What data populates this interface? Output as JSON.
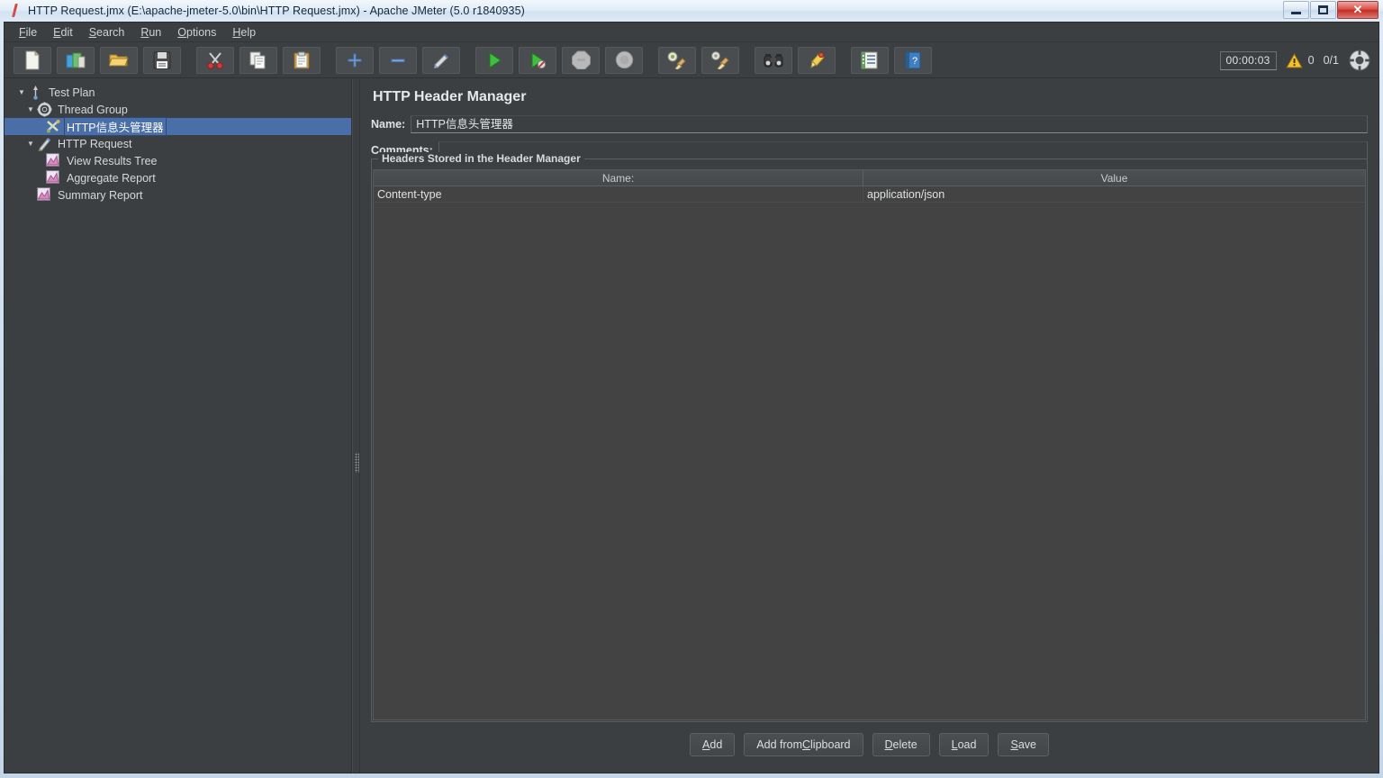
{
  "window": {
    "title": "HTTP Request.jmx (E:\\apache-jmeter-5.0\\bin\\HTTP Request.jmx) - Apache JMeter (5.0 r1840935)",
    "app_icon": "jmeter-feather-icon",
    "controls": {
      "minimize": "minimize-icon",
      "maximize": "maximize-icon",
      "close": "✕"
    }
  },
  "menubar": {
    "items": [
      {
        "label": "File",
        "mnemonic": "F"
      },
      {
        "label": "Edit",
        "mnemonic": "E"
      },
      {
        "label": "Search",
        "mnemonic": "S"
      },
      {
        "label": "Run",
        "mnemonic": "R"
      },
      {
        "label": "Options",
        "mnemonic": "O"
      },
      {
        "label": "Help",
        "mnemonic": "H"
      }
    ]
  },
  "toolbar": {
    "buttons": [
      {
        "name": "new-button",
        "icon": "new-document-icon"
      },
      {
        "name": "templates-button",
        "icon": "templates-icon"
      },
      {
        "name": "open-button",
        "icon": "open-folder-icon"
      },
      {
        "name": "save-button",
        "icon": "save-disk-icon"
      },
      {
        "name": "cut-button",
        "icon": "scissors-icon"
      },
      {
        "name": "copy-button",
        "icon": "copy-icon"
      },
      {
        "name": "paste-button",
        "icon": "clipboard-paste-icon"
      },
      {
        "name": "expand-all-button",
        "icon": "plus-icon"
      },
      {
        "name": "collapse-all-button",
        "icon": "minus-icon"
      },
      {
        "name": "toggle-button",
        "icon": "toggle-pencil-icon"
      },
      {
        "name": "start-button",
        "icon": "play-green-icon"
      },
      {
        "name": "start-no-pauses-button",
        "icon": "play-no-pauses-icon"
      },
      {
        "name": "stop-button",
        "icon": "stop-octagon-icon"
      },
      {
        "name": "shutdown-button",
        "icon": "shutdown-circle-icon"
      },
      {
        "name": "clear-button",
        "icon": "clear-broom-icon"
      },
      {
        "name": "clear-all-button",
        "icon": "clear-all-broom-icon"
      },
      {
        "name": "search-button",
        "icon": "binoculars-icon"
      },
      {
        "name": "reset-search-button",
        "icon": "reset-search-bell-icon"
      },
      {
        "name": "function-helper-button",
        "icon": "function-helper-icon"
      },
      {
        "name": "help-button",
        "icon": "help-book-icon"
      }
    ],
    "separators_after": [
      3,
      6,
      9,
      13,
      15,
      17,
      18
    ],
    "status": {
      "timer": "00:00:03",
      "warning_icon": "warning-triangle-icon",
      "warning_count": "0",
      "thread_count": "0/1",
      "connection_icon": "remote-connection-icon"
    }
  },
  "tree": {
    "nodes": [
      {
        "label": "Test Plan",
        "icon": "test-plan-icon",
        "indent": 0,
        "twisty": "▼",
        "selected": false
      },
      {
        "label": "Thread Group",
        "icon": "thread-group-icon",
        "indent": 1,
        "twisty": "▼",
        "selected": false
      },
      {
        "label": "HTTP信息头管理器",
        "icon": "header-manager-icon",
        "indent": 2,
        "twisty": "",
        "selected": true
      },
      {
        "label": "HTTP Request",
        "icon": "http-request-icon",
        "indent": 1,
        "twisty": "▼",
        "selected": false
      },
      {
        "label": "View Results Tree",
        "icon": "listener-icon",
        "indent": 2,
        "twisty": "",
        "selected": false
      },
      {
        "label": "Aggregate Report",
        "icon": "listener-icon",
        "indent": 2,
        "twisty": "",
        "selected": false
      },
      {
        "label": "Summary Report",
        "icon": "listener-icon",
        "indent": 1,
        "twisty": "",
        "selected": false
      }
    ]
  },
  "main": {
    "panel_title": "HTTP Header Manager",
    "name_label": "Name:",
    "name_value": "HTTP信息头管理器",
    "comments_label": "Comments:",
    "comments_value": "",
    "headers_group_label": "Headers Stored in the Header Manager",
    "table": {
      "columns": [
        "Name:",
        "Value"
      ],
      "rows": [
        {
          "name": "Content-type",
          "value": "application/json"
        }
      ]
    },
    "buttons": [
      {
        "label": "Add",
        "mnemonic": "A",
        "name": "add-button"
      },
      {
        "label": "Add from Clipboard",
        "mnemonic": "C",
        "name": "add-from-clipboard-button"
      },
      {
        "label": "Delete",
        "mnemonic": "D",
        "name": "delete-button"
      },
      {
        "label": "Load",
        "mnemonic": "L",
        "name": "load-button"
      },
      {
        "label": "Save",
        "mnemonic": "S",
        "name": "save-headers-button"
      }
    ]
  },
  "colors": {
    "app_background": "#3c3f41",
    "table_background": "#434343",
    "selection": "#4a6fa8",
    "text": "#d6d9db",
    "window_frame": "#cfe0ef"
  }
}
